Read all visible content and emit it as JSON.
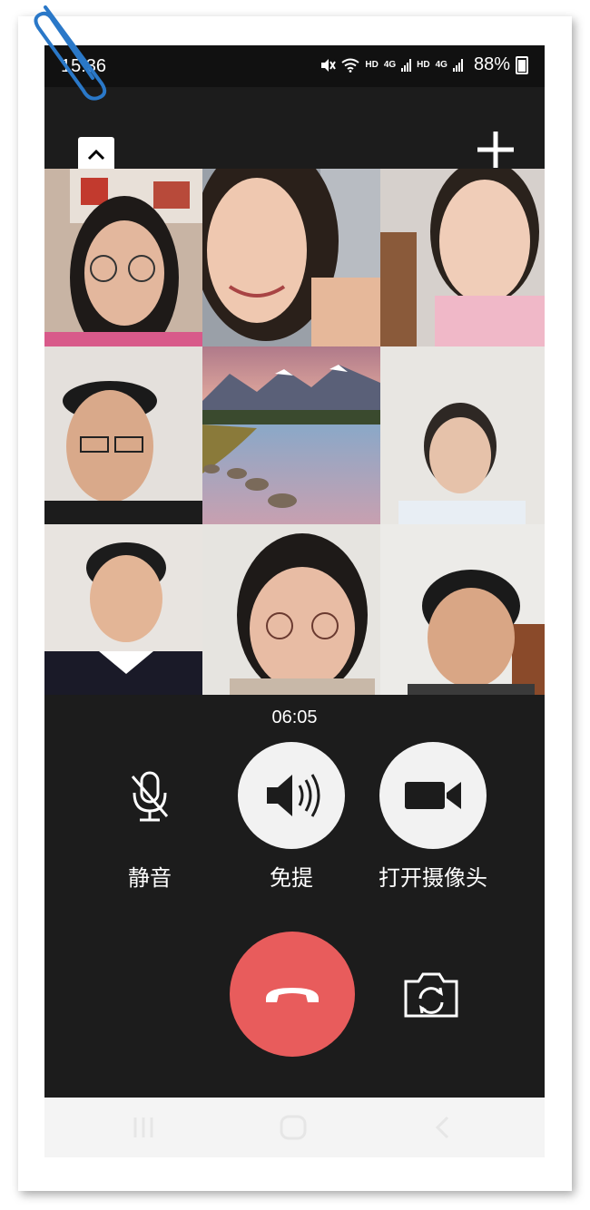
{
  "status_bar": {
    "time": "15:36",
    "hd1": "HD",
    "net1": "4G",
    "hd2": "HD",
    "net2": "4G",
    "battery_percent": "88%"
  },
  "top_bar": {
    "collapse_icon": "chevron-up-icon",
    "add_icon": "plus-icon"
  },
  "participants": [
    {
      "type": "video"
    },
    {
      "type": "video"
    },
    {
      "type": "video"
    },
    {
      "type": "video"
    },
    {
      "type": "avatar-landscape"
    },
    {
      "type": "video"
    },
    {
      "type": "video"
    },
    {
      "type": "video"
    },
    {
      "type": "video"
    }
  ],
  "call": {
    "duration": "06:05"
  },
  "controls": {
    "mute_label": "静音",
    "speaker_label": "免提",
    "camera_label": "打开摄像头"
  },
  "colors": {
    "background": "#1c1c1c",
    "button_light": "#f2f2f2",
    "hangup_red": "#e85c5c"
  },
  "nav": {
    "recent_icon": "recent-apps-icon",
    "home_icon": "home-icon",
    "back_icon": "back-icon"
  }
}
